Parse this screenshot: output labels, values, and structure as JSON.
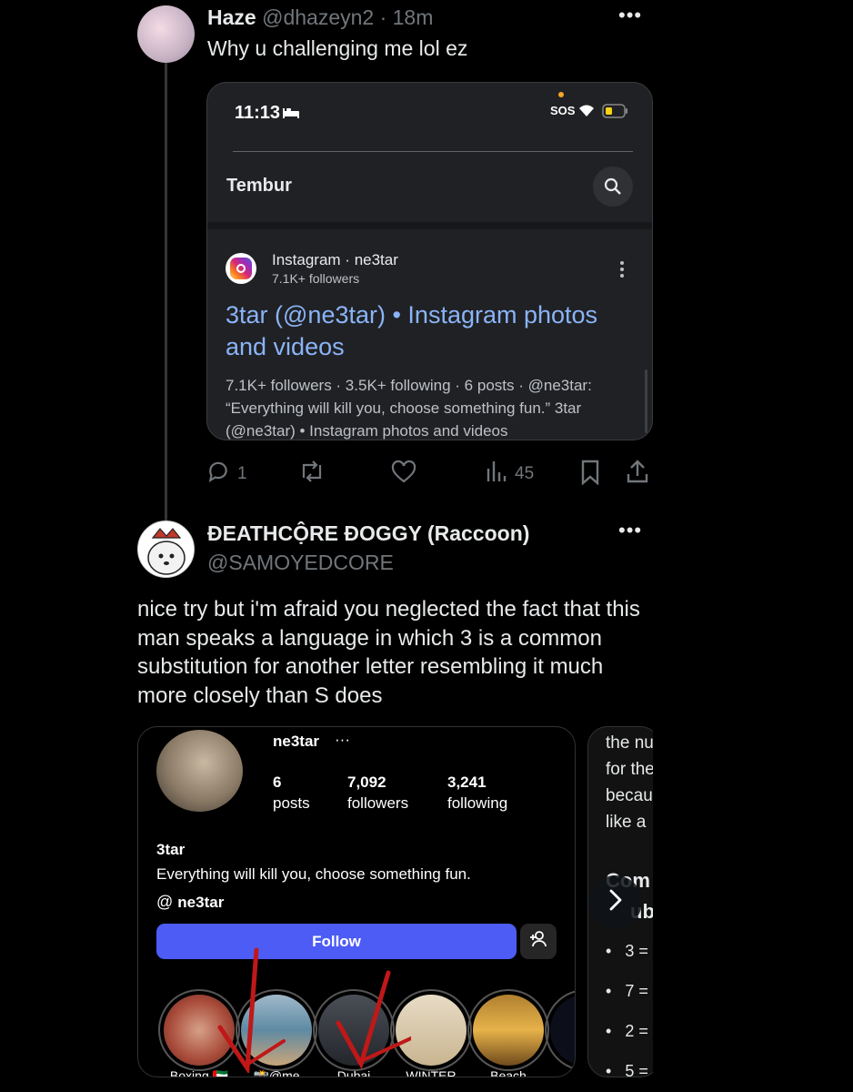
{
  "tweet1": {
    "name": "Haze",
    "handle": "@dhazeyn2",
    "time": "· 18m",
    "text": "Why u challenging me lol ez",
    "more": "•••",
    "screenshot": {
      "time": "11:13",
      "sos": "SOS",
      "search_query": "Tembur",
      "source": "Instagram · ne3tar",
      "source_followers": "7.1K+ followers",
      "result_title": "3tar (@ne3tar) • Instagram photos and videos",
      "result_snippet": "7.1K+ followers · 3.5K+ following · 6 posts · @ne3tar: “Everything will kill you, choose something fun.” 3tar (@ne3tar) • Instagram photos and videos"
    },
    "actions": {
      "replies": "1",
      "views": "45"
    }
  },
  "tweet2": {
    "name": "ĐEATHCỘRE ĐOGGY (Raccoon)",
    "handle": "@SAMOYEDCORE",
    "more": "•••",
    "text": "nice try but i'm afraid you neglected the fact that this man speaks a language in which 3 is a common substitution for another letter resembling it much more closely than S does",
    "ig": {
      "username": "ne3tar",
      "more": "···",
      "posts_n": "6",
      "posts_l": "posts",
      "followers_n": "7,092",
      "followers_l": "followers",
      "following_n": "3,241",
      "following_l": "following",
      "display_name": "3tar",
      "bio": "Everything will kill you, choose something fun.",
      "threads": "ne3tar",
      "follow": "Follow",
      "highlights": [
        "Boxing 🇦🇪",
        "📸@me",
        "Dubai",
        "WINTER",
        "Beach",
        ""
      ]
    },
    "side_card": {
      "lines": [
        "the nu",
        "for the",
        "becau",
        "like a"
      ],
      "heading1": "Com",
      "heading2": "ub",
      "bullets": [
        "3 =",
        "7 =",
        "2 =",
        "5 ="
      ]
    }
  },
  "colors": {
    "link_blue": "#8ab4f8",
    "follow_blue": "#4d5cf5",
    "handle_gray": "#71767b"
  }
}
